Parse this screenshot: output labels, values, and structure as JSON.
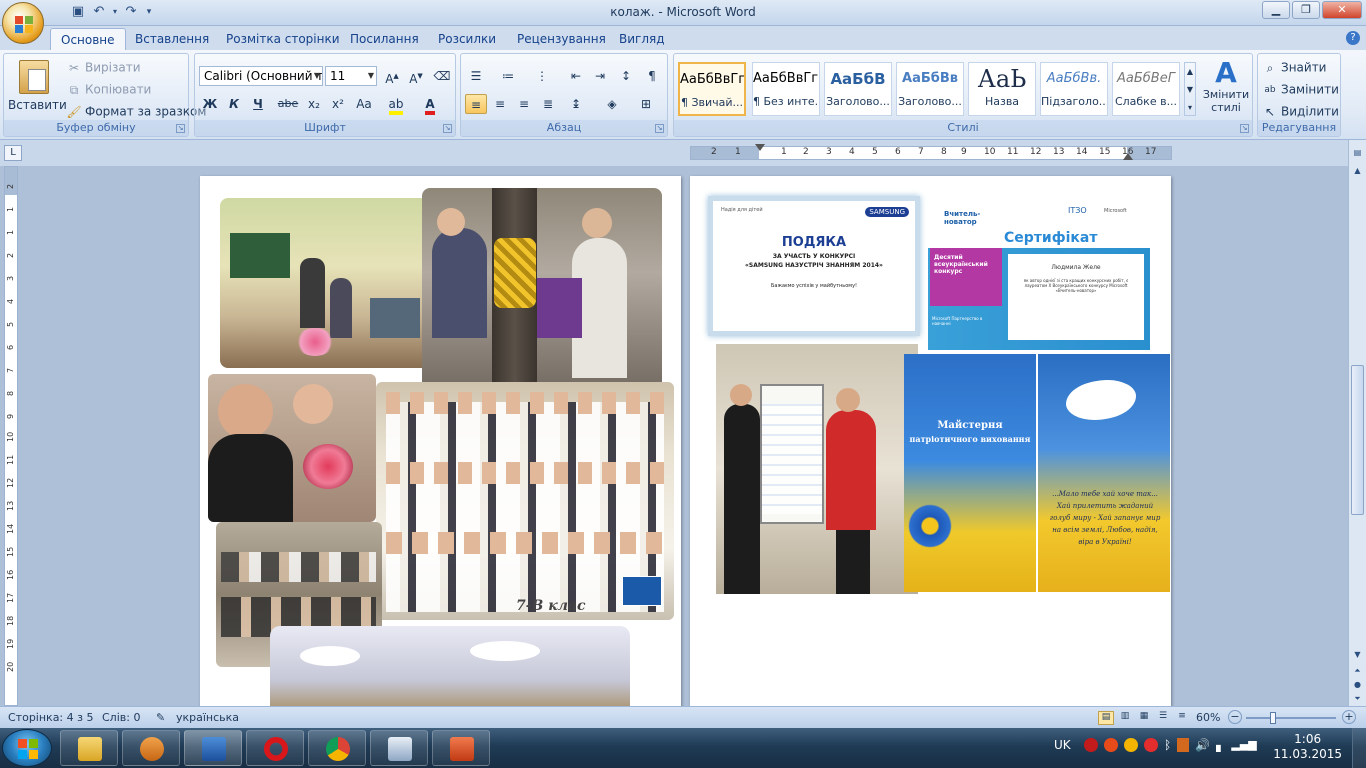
{
  "window": {
    "title": "колаж. - Microsoft Word",
    "minimize_icon": "minimize-icon",
    "maximize_icon": "restore-icon",
    "close_icon": "close-icon"
  },
  "quick_access": [
    "word-icon",
    "save-icon",
    "undo-icon",
    "redo-icon",
    "customize-icon"
  ],
  "tabs": [
    {
      "label": "Основне",
      "active": true
    },
    {
      "label": "Вставлення"
    },
    {
      "label": "Розмітка сторінки"
    },
    {
      "label": "Посилання"
    },
    {
      "label": "Розсилки"
    },
    {
      "label": "Рецензування"
    },
    {
      "label": "Вигляд"
    }
  ],
  "ribbon": {
    "clipboard": {
      "label": "Буфер обміну",
      "paste": "Вставити",
      "cut": "Вирізати",
      "copy": "Копіювати",
      "format_painter": "Формат за зразком"
    },
    "font": {
      "label": "Шрифт",
      "font_name": "Calibri (Основний те",
      "font_size": "11",
      "bold": "Ж",
      "italic": "К",
      "underline": "Ч",
      "strike": "abe",
      "subscript": "x₂",
      "superscript": "x²",
      "change_case": "Aa"
    },
    "paragraph": {
      "label": "Абзац"
    },
    "styles": {
      "label": "Стилі",
      "items": [
        {
          "preview": "АаБбВвГг,",
          "name": "¶ Звичай...",
          "selected": true
        },
        {
          "preview": "АаБбВвГг,",
          "name": "¶ Без инте..."
        },
        {
          "preview": "АаБбВ",
          "name": "Заголово..."
        },
        {
          "preview": "АаБбВв",
          "name": "Заголово..."
        },
        {
          "preview": "АаЬ",
          "name": "Назва"
        },
        {
          "preview": "АаБбВв.",
          "name": "Підзаголо..."
        },
        {
          "preview": "АаБбВеГ",
          "name": "Слабке в..."
        }
      ],
      "change_styles": "Змінити стилі"
    },
    "editing": {
      "label": "Редагування",
      "find": "Знайти",
      "replace": "Замінити",
      "select": "Виділити"
    }
  },
  "ruler_numbers": [
    "2",
    "1",
    "1",
    "2",
    "3",
    "4",
    "5",
    "6",
    "7",
    "8",
    "9",
    "10",
    "11",
    "12",
    "13",
    "14",
    "15",
    "16",
    "17"
  ],
  "vruler_numbers": [
    "2",
    "1",
    "1",
    "2",
    "3",
    "4",
    "5",
    "6",
    "7",
    "8",
    "9",
    "10",
    "11",
    "12",
    "13",
    "14",
    "15",
    "16",
    "17",
    "18",
    "19",
    "20"
  ],
  "statusbar": {
    "page": "Сторінка: 4 з 5",
    "words": "Слів: 0",
    "language": "українська",
    "zoom": "60%",
    "zoom_level": 0.6
  },
  "taskbar": {
    "language": "UK",
    "time": "1:06",
    "date": "11.03.2015"
  },
  "page2": {
    "podyaka_title": "ПОДЯКА",
    "podyaka_sub1": "ЗА УЧАСТЬ У КОНКУРСІ",
    "podyaka_sub2": "«SAMSUNG НАЗУСТРІЧ ЗНАННЯМ 2014»",
    "podyaka_wish": "Бажаємо успіхів у майбутньому!",
    "podyaka_brand": "SAMSUNG",
    "podyaka_logo": "Надія для дітей",
    "cert_title": "Сертифікат",
    "cert_brand": "Вчитель-новатор",
    "cert_itzo": "ІТЗО",
    "cert_ms": "Microsoft",
    "cert_contest": "Десятий всеукраїнський конкурс",
    "cert_name": "Людмила Желе",
    "cert_body": "як автор однієї зі ста кращих конкурсних робіт, є лауреатом X Всеукраїнського конкурсу Microsoft «Вчитель-новатор»",
    "cert_partner": "Microsoft Партнерство в навчанні",
    "mai_title": "Майстерня",
    "mai_sub": "патріотичного виховання",
    "mai_text": "...Мало тебе хай хоче так... Хай прилетить жаданий голуб миру - Хай запанує мир на всім землі, Любов, надія, віра в Україні!",
    "class_label": "7-В клас"
  }
}
